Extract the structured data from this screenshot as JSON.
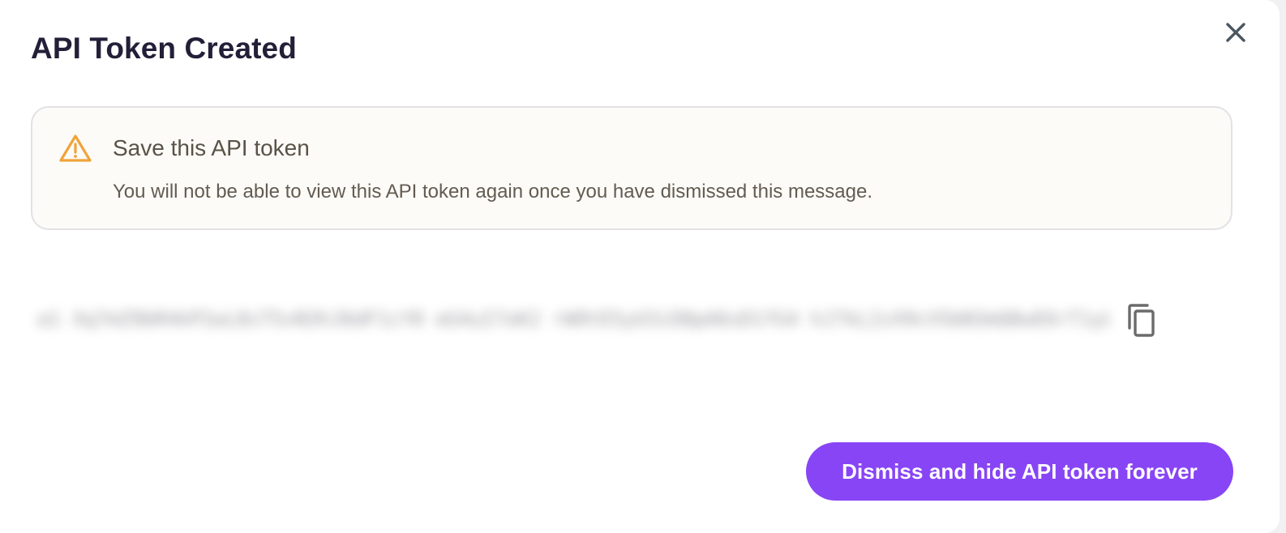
{
  "dialog": {
    "title": "API Token Created",
    "close_icon": "close-icon"
  },
  "alert": {
    "icon": "warning-icon",
    "icon_color": "#f0a33a",
    "title": "Save this API token",
    "message": "You will not be able to view this API token again once you have dismissed this message."
  },
  "token": {
    "value": "a1  Xq7mZ9bR4kP2wL8sT5vN3hJ6dF1cY0  eG4uI7oK2  rW9tE5yU3iO8pA6sD1fG4  hJ7kL2zX9cV5bN3mQ8wE6rT1yU4iO7  pA2sD5fG8hJ3  kL6zX9cV2bN5mQ8wE1rT4yU7iO0pA3  sD6fG9  hJ2kL5zX",
    "copy_icon": "copy-icon"
  },
  "actions": {
    "dismiss_label": "Dismiss and hide API token forever",
    "accent_color": "#8845f5"
  }
}
